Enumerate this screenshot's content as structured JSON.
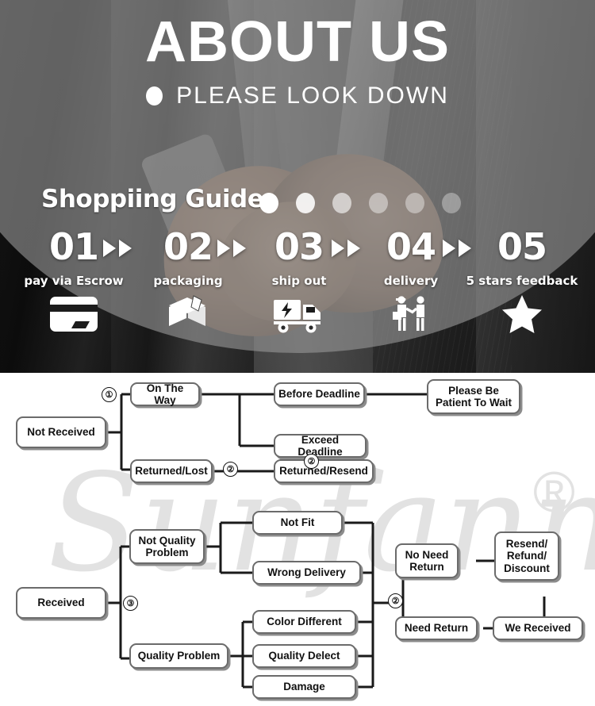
{
  "hero": {
    "title": "ABOUT US",
    "subtitle": "PLEASE LOOK DOWN",
    "bullet_icon": "bullet-dot-icon"
  },
  "guide": {
    "title": "Shoppiing Guide",
    "dot_count": 6,
    "steps": [
      {
        "num": "01",
        "label": "pay via Escrow",
        "icon": "credit-card-icon"
      },
      {
        "num": "02",
        "label": "packaging",
        "icon": "package-box-icon"
      },
      {
        "num": "03",
        "label": "ship out",
        "icon": "delivery-truck-icon"
      },
      {
        "num": "04",
        "label": "delivery",
        "icon": "handshake-delivery-icon"
      },
      {
        "num": "05",
        "label": "5 stars feedback",
        "icon": "star-icon"
      }
    ],
    "arrow_icon": "double-triangle-arrow-icon"
  },
  "watermark": {
    "text": "Sunfanny",
    "registered_mark": "®"
  },
  "flowchart": {
    "markers": {
      "m1": "①",
      "m2a": "②",
      "m2b": "②",
      "m2c": "②",
      "m3": "③"
    },
    "nodes": {
      "not_received": "Not Received",
      "on_the_way": "On The Way",
      "returned_lost": "Returned/Lost",
      "before_deadline": "Before Deadline",
      "exceed_deadline": "Exceed Deadline",
      "returned_resend": "Returned/Resend",
      "please_be_patient": "Please Be\nPatient To Wait",
      "received": "Received",
      "not_quality_problem": "Not Quality\nProblem",
      "quality_problem": "Quality Problem",
      "not_fit": "Not Fit",
      "wrong_delivery": "Wrong Delivery",
      "color_different": "Color Different",
      "quality_delect": "Quality Delect",
      "damage": "Damage",
      "no_need_return": "No Need\nReturn",
      "need_return": "Need Return",
      "resend_refund_discount": "Resend/\nRefund/\nDiscount",
      "we_received": "We Received"
    }
  },
  "colors": {
    "node_border": "#6b6b6b",
    "node_shadow": "#8c8c8c",
    "text": "#111111",
    "watermark": "#e2e2e2",
    "hero_overlay": "rgba(150,150,150,.62)",
    "white": "#ffffff"
  }
}
